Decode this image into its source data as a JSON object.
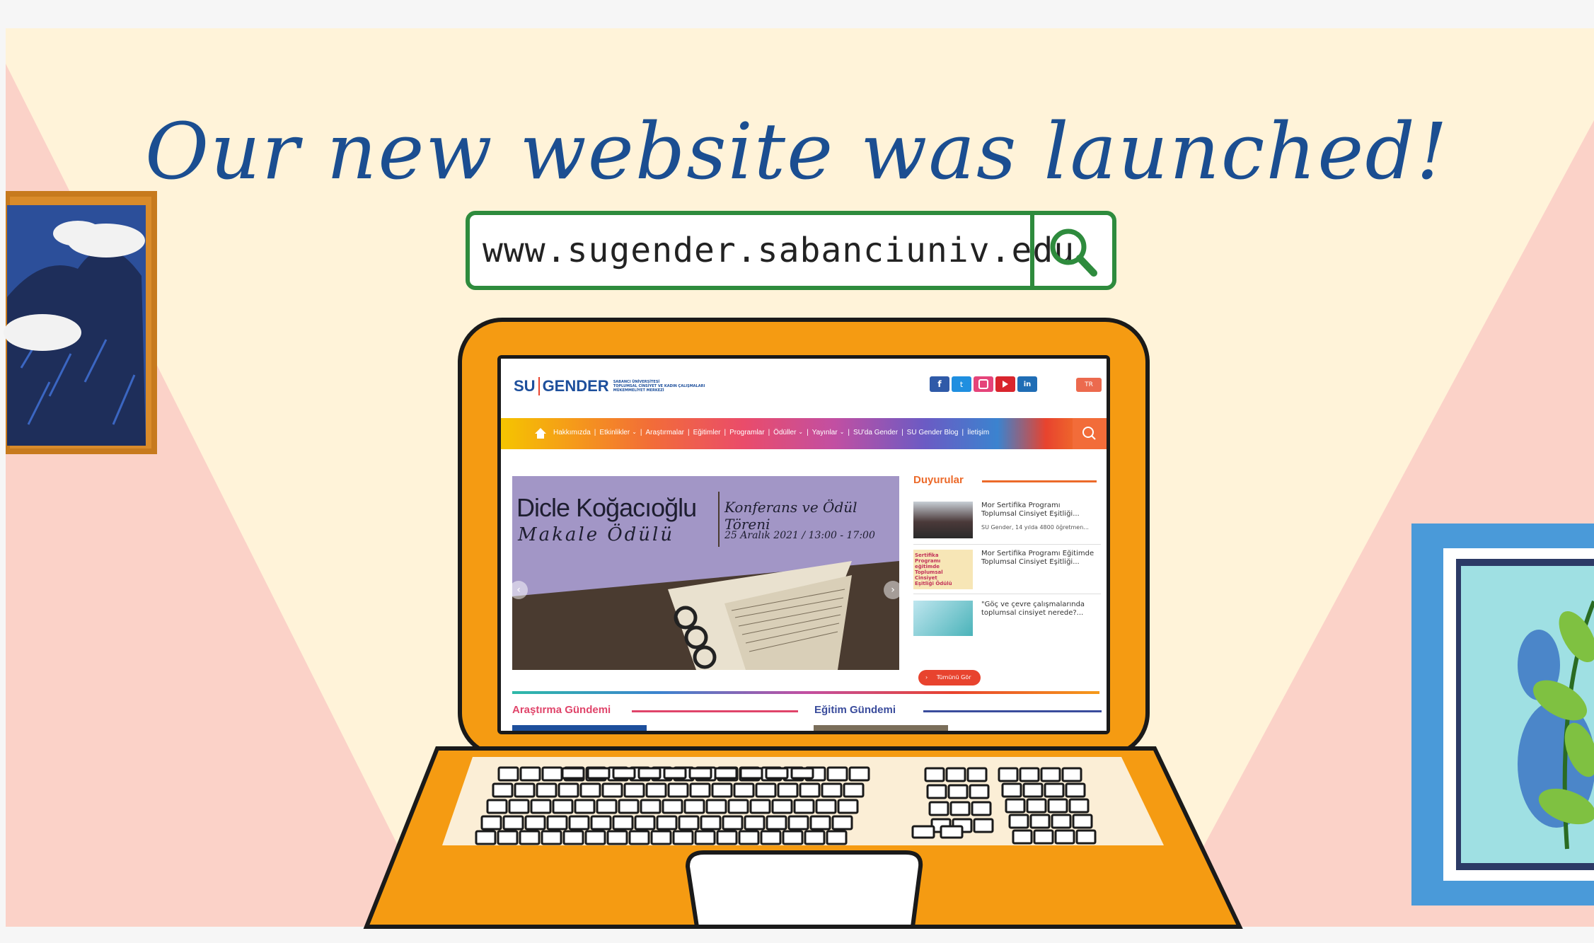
{
  "headline": "Our new website was launched!",
  "url": "www.sugender.sabanciuniv.edu",
  "site": {
    "logo_su": "SU",
    "logo_gender": "GENDER",
    "logo_sub1": "SABANCI ÜNİVERSİTESİ",
    "logo_sub2": "TOPLUMSAL CİNSİYET VE KADIN ÇALIŞMALARI",
    "logo_sub3": "MÜKEMMELİYET MERKEZİ",
    "lang": "TR",
    "social": [
      "f",
      "t",
      "ig",
      "yt",
      "in"
    ],
    "nav": [
      "Hakkımızda",
      "Etkinlikler",
      "Araştırmalar",
      "Eğitimler",
      "Programlar",
      "Ödüller",
      "Yayınlar",
      "SU'da Gender",
      "SU Gender Blog",
      "İletişim"
    ],
    "banner": {
      "name": "Dicle Koğacıoğlu",
      "award": "Makale Ödülü",
      "event": "Konferans ve Ödül Töreni",
      "date": "25 Aralık 2021 / 13:00 - 17:00"
    },
    "announcements_title": "Duyurular",
    "announcements": [
      {
        "title1": "Mor Sertifika Programı",
        "title2": "Toplumsal Cinsiyet Eşitliği...",
        "sub": "SU Gender, 14 yılda 4800 öğretmen..."
      },
      {
        "title1": "Mor Sertifika Programı Eğitimde",
        "title2": "Toplumsal Cinsiyet Eşitliği...",
        "sub": ""
      },
      {
        "title1": "\"Göç ve çevre çalışmalarında",
        "title2": "toplumsal cinsiyet nerede?...",
        "sub": ""
      }
    ],
    "thumb2_text": "Sertifika Programı eğitimde Toplumsal Cinsiyet Eşitliği Ödülü",
    "see_all": "Tümünü Gör",
    "section_left": "Araştırma Gündemi",
    "section_right": "Eğitim Gündemi"
  }
}
